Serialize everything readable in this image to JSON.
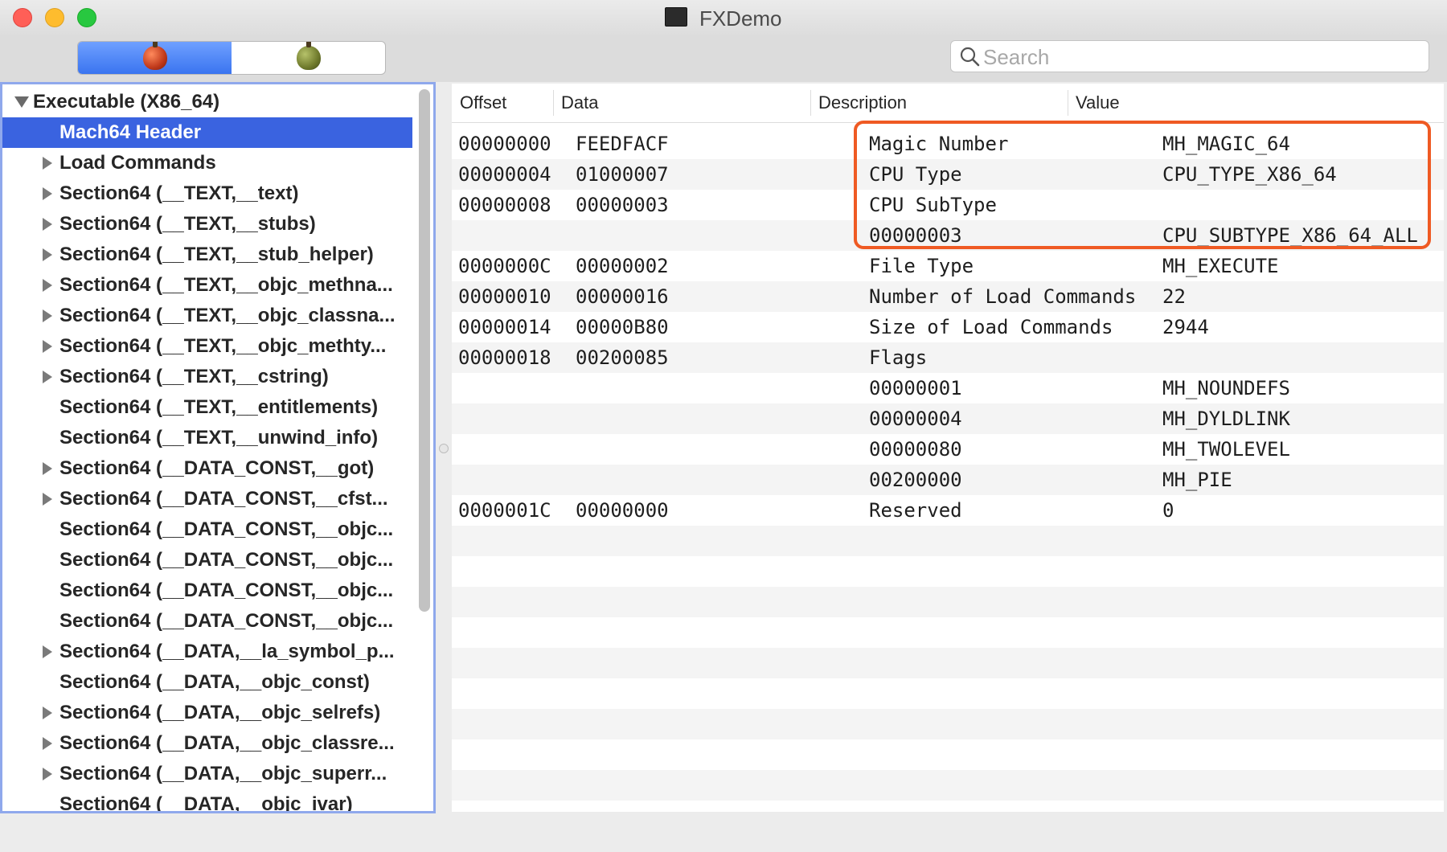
{
  "window": {
    "title": "FXDemo"
  },
  "toolbar": {
    "segments": [
      {
        "icon": "red-apple-icon",
        "active": true
      },
      {
        "icon": "green-apple-icon",
        "active": false
      }
    ],
    "search": {
      "placeholder": "Search",
      "value": ""
    }
  },
  "tree": {
    "root": "Executable  (X86_64)",
    "items": [
      {
        "label": "Mach64 Header",
        "expandable": false,
        "selected": true
      },
      {
        "label": "Load Commands",
        "expandable": true
      },
      {
        "label": "Section64 (__TEXT,__text)",
        "expandable": true
      },
      {
        "label": "Section64 (__TEXT,__stubs)",
        "expandable": true
      },
      {
        "label": "Section64 (__TEXT,__stub_helper)",
        "expandable": true
      },
      {
        "label": "Section64 (__TEXT,__objc_methna...",
        "expandable": true
      },
      {
        "label": "Section64 (__TEXT,__objc_classna...",
        "expandable": true
      },
      {
        "label": "Section64 (__TEXT,__objc_methty...",
        "expandable": true
      },
      {
        "label": "Section64 (__TEXT,__cstring)",
        "expandable": true
      },
      {
        "label": "Section64 (__TEXT,__entitlements)",
        "expandable": false
      },
      {
        "label": "Section64 (__TEXT,__unwind_info)",
        "expandable": false
      },
      {
        "label": "Section64 (__DATA_CONST,__got)",
        "expandable": true
      },
      {
        "label": "Section64 (__DATA_CONST,__cfst...",
        "expandable": true
      },
      {
        "label": "Section64 (__DATA_CONST,__objc...",
        "expandable": false
      },
      {
        "label": "Section64 (__DATA_CONST,__objc...",
        "expandable": false
      },
      {
        "label": "Section64 (__DATA_CONST,__objc...",
        "expandable": false
      },
      {
        "label": "Section64 (__DATA_CONST,__objc...",
        "expandable": false
      },
      {
        "label": "Section64 (__DATA,__la_symbol_p...",
        "expandable": true
      },
      {
        "label": "Section64 (__DATA,__objc_const)",
        "expandable": false
      },
      {
        "label": "Section64 (__DATA,__objc_selrefs)",
        "expandable": true
      },
      {
        "label": "Section64 (__DATA,__objc_classre...",
        "expandable": true
      },
      {
        "label": "Section64 (__DATA,__objc_superr...",
        "expandable": true
      },
      {
        "label": "Section64 (__DATA,__objc_ivar)",
        "expandable": false
      }
    ]
  },
  "table": {
    "columns": [
      "Offset",
      "Data",
      "Description",
      "Value"
    ],
    "rows": [
      {
        "offset": "00000000",
        "data": "FEEDFACF",
        "description": "Magic Number",
        "value": "MH_MAGIC_64"
      },
      {
        "offset": "00000004",
        "data": "01000007",
        "description": "CPU Type",
        "value": "CPU_TYPE_X86_64"
      },
      {
        "offset": "00000008",
        "data": "00000003",
        "description": "CPU SubType",
        "value": ""
      },
      {
        "offset": "",
        "data": "",
        "description": "00000003",
        "value": "CPU_SUBTYPE_X86_64_ALL"
      },
      {
        "offset": "0000000C",
        "data": "00000002",
        "description": "File Type",
        "value": "MH_EXECUTE"
      },
      {
        "offset": "00000010",
        "data": "00000016",
        "description": "Number of Load Commands",
        "value": "22"
      },
      {
        "offset": "00000014",
        "data": "00000B80",
        "description": "Size of Load Commands",
        "value": "2944"
      },
      {
        "offset": "00000018",
        "data": "00200085",
        "description": "Flags",
        "value": ""
      },
      {
        "offset": "",
        "data": "",
        "description": "00000001",
        "value": "MH_NOUNDEFS"
      },
      {
        "offset": "",
        "data": "",
        "description": "00000004",
        "value": "MH_DYLDLINK"
      },
      {
        "offset": "",
        "data": "",
        "description": "00000080",
        "value": "MH_TWOLEVEL"
      },
      {
        "offset": "",
        "data": "",
        "description": "00200000",
        "value": "MH_PIE"
      },
      {
        "offset": "0000001C",
        "data": "00000000",
        "description": "Reserved",
        "value": "0"
      }
    ],
    "highlight_color": "#ef5a23"
  },
  "colors": {
    "selection": "#3a63e0",
    "sidebar_border": "#8fa8ec"
  }
}
